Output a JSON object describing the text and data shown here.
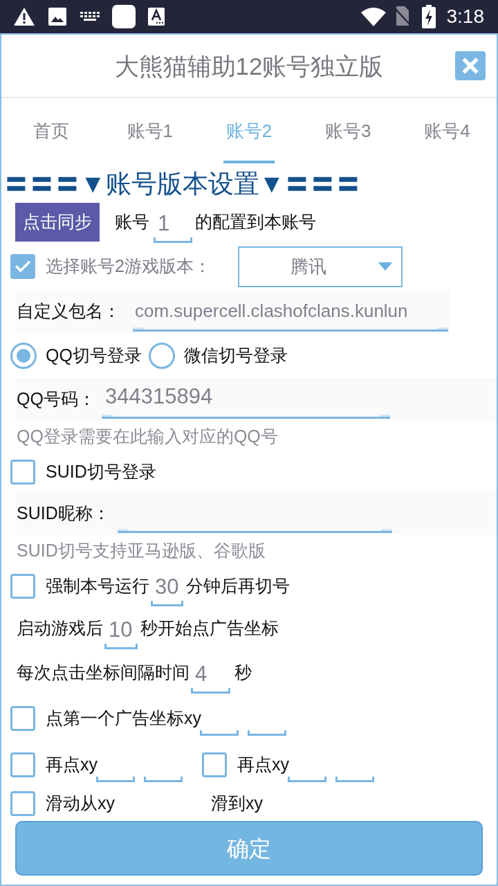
{
  "status_bar": {
    "time": "3:18"
  },
  "dialog": {
    "title": "大熊猫辅助12账号独立版"
  },
  "tabs": [
    {
      "label": "首页",
      "selected": false
    },
    {
      "label": "账号1",
      "selected": false
    },
    {
      "label": "账号2",
      "selected": true
    },
    {
      "label": "账号3",
      "selected": false
    },
    {
      "label": "账号4",
      "selected": false
    }
  ],
  "section_header": "〓〓〓▼账号版本设置▼〓〓〓",
  "sync_row": {
    "button": "点击同步",
    "prefix": "账号",
    "account_value": "1",
    "suffix": "的配置到本账号"
  },
  "version_row": {
    "checked": true,
    "label": "选择账号2游戏版本：",
    "dropdown_value": "腾讯"
  },
  "package_row": {
    "label": "自定义包名：",
    "value": "com.supercell.clashofclans.kunlun"
  },
  "login_options": [
    {
      "label": "QQ切号登录",
      "selected": true
    },
    {
      "label": "微信切号登录",
      "selected": false
    }
  ],
  "qq_row": {
    "label": "QQ号码：",
    "value": "344315894",
    "hint": "QQ登录需要在此输入对应的QQ号"
  },
  "suid_option": {
    "label": "SUID切号登录",
    "checked": false
  },
  "suid_row": {
    "label": "SUID昵称：",
    "hint": "SUID切号支持亚马逊版、谷歌版"
  },
  "force_row": {
    "checked": false,
    "before": "强制本号运行",
    "value": "30",
    "after": "分钟后再切号"
  },
  "delay_row": {
    "before": "启动游戏后",
    "value": "10",
    "after": "秒开始点广告坐标"
  },
  "interval_row": {
    "before": "每次点击坐标间隔时间",
    "value": "4",
    "after": "秒"
  },
  "coordinate_rows": [
    [
      {
        "checked": false,
        "label": "点第一个广告坐标xy"
      }
    ],
    [
      {
        "checked": false,
        "label": "再点xy"
      },
      {
        "checked": false,
        "label": "再点xy"
      }
    ]
  ],
  "swipe_row": {
    "checked": false,
    "from_label": "滑动从xy",
    "to_label": "滑到xy"
  },
  "confirm_button": "确定"
}
